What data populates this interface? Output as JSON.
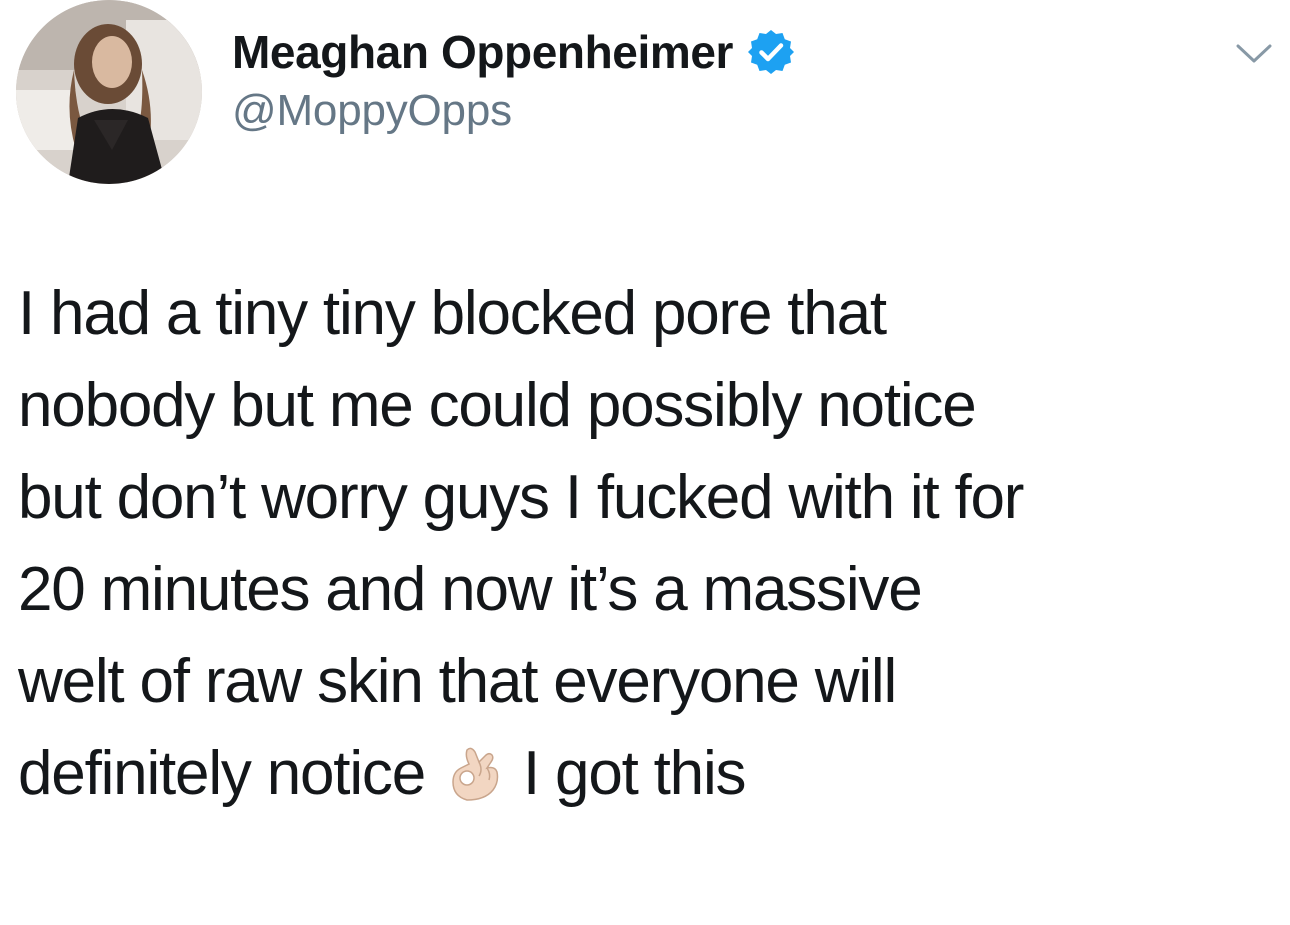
{
  "tweet": {
    "author": {
      "display_name": "Meaghan Oppenheimer",
      "handle": "@MoppyOpps",
      "verified": true,
      "verified_icon": "verified-badge-icon",
      "verified_color": "#1da1f2"
    },
    "menu_icon": "chevron-down-icon",
    "text_lines": [
      "I had a tiny tiny blocked pore that",
      "nobody but me could possibly notice",
      "but don’t worry guys I fucked with it for",
      "20 minutes and now it’s a massive",
      "welt of raw skin that everyone will",
      "definitely notice"
    ],
    "emoji": "ok-hand-emoji",
    "text_after_emoji": "I got this"
  },
  "colors": {
    "text": "#14171a",
    "handle": "#657786",
    "background": "#ffffff"
  }
}
